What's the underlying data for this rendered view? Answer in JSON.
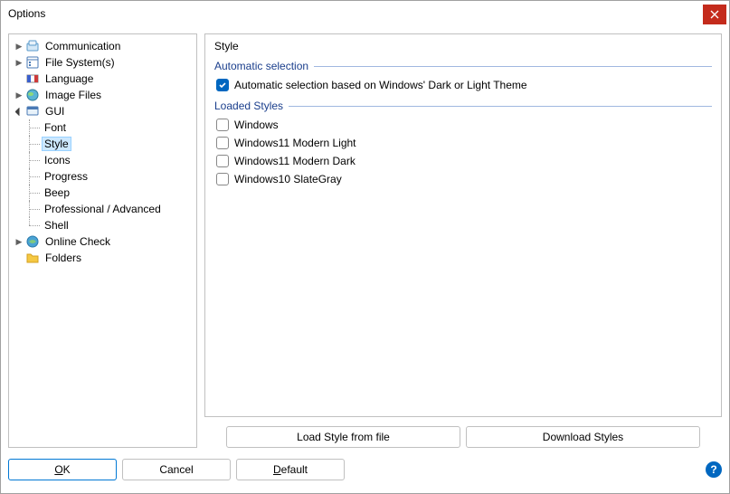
{
  "window": {
    "title": "Options"
  },
  "tree": {
    "items": [
      {
        "label": "Communication",
        "icon": "comm"
      },
      {
        "label": "File System(s)",
        "icon": "filesys"
      },
      {
        "label": "Language",
        "icon": "lang"
      },
      {
        "label": "Image Files",
        "icon": "imagefiles"
      },
      {
        "label": "GUI",
        "icon": "gui",
        "expanded": true,
        "children": [
          {
            "label": "Font"
          },
          {
            "label": "Style",
            "selected": true
          },
          {
            "label": "Icons"
          },
          {
            "label": "Progress"
          },
          {
            "label": "Beep"
          },
          {
            "label": "Professional / Advanced"
          },
          {
            "label": "Shell"
          }
        ]
      },
      {
        "label": "Online Check",
        "icon": "online"
      },
      {
        "label": "Folders",
        "icon": "folders"
      }
    ]
  },
  "main": {
    "title": "Style",
    "group1": "Automatic selection",
    "auto_label": "Automatic selection based on Windows' Dark or Light Theme",
    "group2": "Loaded Styles",
    "styles": [
      "Windows",
      "Windows11 Modern Light",
      "Windows11 Modern Dark",
      "Windows10 SlateGray"
    ],
    "load_button": "Load Style from file",
    "download_button": "Download Styles"
  },
  "footer": {
    "ok": "OK",
    "cancel": "Cancel",
    "default": "Default"
  }
}
